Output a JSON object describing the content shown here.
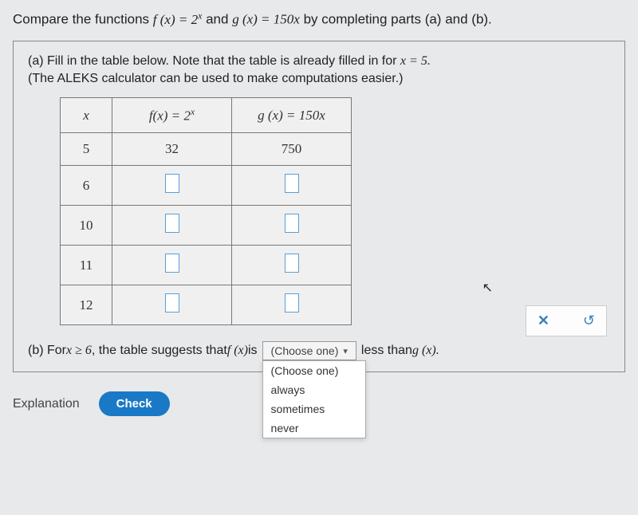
{
  "question_header": {
    "prefix": "Compare the functions ",
    "fx": "f (x) = 2",
    "fx_sup": "x",
    "mid": " and ",
    "gx": "g (x) = 150x",
    "suffix": " by completing parts (a) and (b)."
  },
  "part_a": {
    "line1_pre": "(a) Fill in the table below. Note that the table is already filled in for ",
    "line1_eq": "x = 5.",
    "line2": "(The ALEKS calculator can be used to make computations easier.)"
  },
  "table": {
    "headers": {
      "x": "x",
      "fx_pre": "f(x) = 2",
      "fx_sup": "x",
      "gx": "g (x) = 150x"
    },
    "rows": [
      {
        "x": "5",
        "f": "32",
        "g": "750",
        "filled": true
      },
      {
        "x": "6",
        "f": "",
        "g": "",
        "filled": false
      },
      {
        "x": "10",
        "f": "",
        "g": "",
        "filled": false
      },
      {
        "x": "11",
        "f": "",
        "g": "",
        "filled": false
      },
      {
        "x": "12",
        "f": "",
        "g": "",
        "filled": false
      }
    ]
  },
  "part_b": {
    "prefix": "(b) For ",
    "cond": "x ≥ 6",
    "mid": ", the table suggests that ",
    "fx": "f (x)",
    "is": " is",
    "suffix_pre": " less than ",
    "gx": "g (x).",
    "dropdown_label": "(Choose one)",
    "options": [
      "(Choose one)",
      "always",
      "sometimes",
      "never"
    ]
  },
  "buttons": {
    "explanation": "Explanation",
    "check": "Check"
  },
  "icons": {
    "close": "✕",
    "reset": "↺"
  }
}
